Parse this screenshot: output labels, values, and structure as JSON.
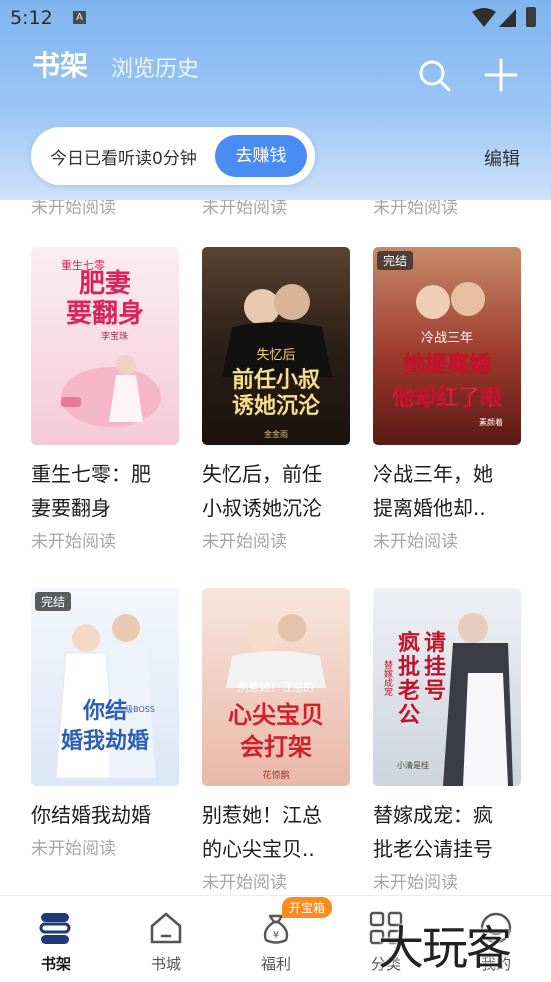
{
  "status_bar": {
    "time": "5:12",
    "notif_icon": "A"
  },
  "header": {
    "tab_active": "书架",
    "tab_other": "浏览历史",
    "search_icon": "search-icon",
    "add_icon": "plus-icon",
    "reading": {
      "text": "今日已看听读0分钟",
      "button": "去赚钱"
    },
    "edit": "编辑"
  },
  "books": [
    {
      "title": "重生七零：肥妻要翻身",
      "title_lines": [
        "重生七零：肥",
        "妻要翻身"
      ],
      "status": "未开始阅读",
      "badge": "",
      "cover_text": "肥妻要翻身",
      "cover_sub": "重生七零",
      "author": "李宝珠"
    },
    {
      "title": "失忆后，前任小叔诱她沉沦",
      "title_lines": [
        "失忆后，前任",
        "小叔诱她沉沦"
      ],
      "status": "未开始阅读",
      "badge": "",
      "cover_text": "前任小叔诱她沉沦",
      "cover_sub": "失忆后",
      "author": "金金雨"
    },
    {
      "title": "冷战三年，她提离婚他却..",
      "title_lines": [
        "冷战三年，她",
        "提离婚他却.."
      ],
      "status": "未开始阅读",
      "badge": "完结",
      "cover_text": "她提离婚他却红了眼",
      "cover_sub": "冷战三年",
      "author": "素颜着"
    },
    {
      "title": "你结婚我劫婚",
      "title_lines": [
        "你结婚我劫婚"
      ],
      "status": "未开始阅读",
      "badge": "完结",
      "cover_text": "你结婚我劫婚",
      "cover_sub": "一级BOSS",
      "author": ""
    },
    {
      "title": "别惹她！江总的心尖宝贝..",
      "title_lines": [
        "别惹她！江总",
        "的心尖宝贝.."
      ],
      "status": "未开始阅读",
      "badge": "",
      "cover_text": "心尖宝贝会打架",
      "cover_sub": "别惹她！江总的",
      "author": "花惊鹊"
    },
    {
      "title": "替嫁成宠：疯批老公请挂号",
      "title_lines": [
        "替嫁成宠：疯",
        "批老公请挂号"
      ],
      "status": "未开始阅读",
      "badge": "",
      "cover_text": "疯批老公请挂号",
      "cover_sub": "替嫁成宠",
      "author": "小清是桂"
    }
  ],
  "prev_row_status": "未开始阅读",
  "bottom_nav": [
    {
      "label": "书架",
      "icon": "bookshelf-icon",
      "active": true
    },
    {
      "label": "书城",
      "icon": "store-icon",
      "active": false
    },
    {
      "label": "福利",
      "icon": "moneybag-icon",
      "active": false,
      "badge": "开宝箱"
    },
    {
      "label": "分类",
      "icon": "category-icon",
      "active": false
    },
    {
      "label": "我的",
      "icon": "profile-icon",
      "active": false
    }
  ],
  "watermark": "大玩客",
  "colors": {
    "accent": "#4a8cf2",
    "header_top": "#7fb4ee",
    "badge_orange": "#ff8a1f",
    "muted": "#a6a6a6"
  }
}
